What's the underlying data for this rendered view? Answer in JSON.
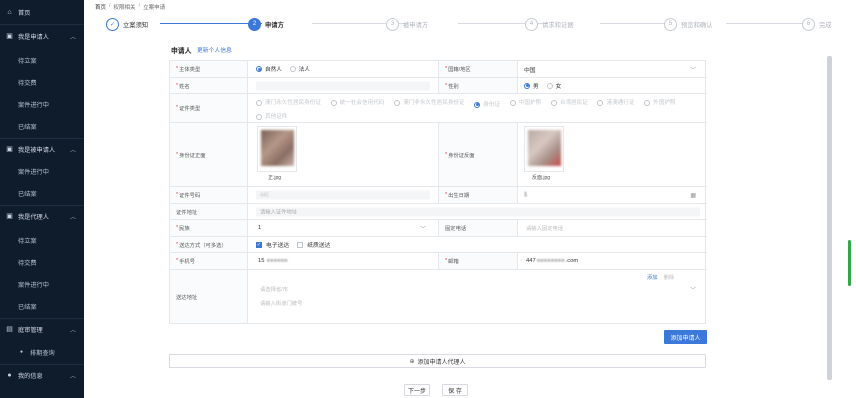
{
  "sidebar": {
    "home": "首页",
    "groups": [
      {
        "label": "我是申请人",
        "items": [
          "待立案",
          "待交费",
          "案件进行中",
          "已结案"
        ]
      },
      {
        "label": "我是被申请人",
        "items": [
          "案件进行中",
          "已结案"
        ]
      },
      {
        "label": "我是代理人",
        "items": [
          "待立案",
          "待交费",
          "案件进行中",
          "已结案"
        ]
      },
      {
        "label": "庭审管理",
        "items": [
          "排期查询"
        ]
      },
      {
        "label": "我的信息",
        "items": []
      }
    ]
  },
  "breadcrumb": [
    "首页",
    "权限相关",
    "立案申请"
  ],
  "steps": [
    {
      "num": "✓",
      "label": "立案须知",
      "state": "done"
    },
    {
      "num": "2",
      "label": "申请方",
      "state": "active"
    },
    {
      "num": "3",
      "label": "被申请方",
      "state": "todo"
    },
    {
      "num": "4",
      "label": "请求和证据",
      "state": "todo"
    },
    {
      "num": "5",
      "label": "预览和确认",
      "state": "todo"
    },
    {
      "num": "6",
      "label": "完成",
      "state": "todo"
    }
  ],
  "section": {
    "title": "申请人",
    "update_link": "更新个人信息"
  },
  "form": {
    "subject_type": {
      "label": "主体类型",
      "options": [
        "自然人",
        "法人"
      ],
      "selected": "自然人"
    },
    "nationality": {
      "label": "国籍/地区",
      "value": "中国"
    },
    "name": {
      "label": "姓名",
      "value": ""
    },
    "gender": {
      "label": "性别",
      "options": [
        "男",
        "女"
      ],
      "selected": "男"
    },
    "id_type": {
      "label": "证件类型",
      "options": [
        "澳门永久性居民身份证",
        "统一社会信用代码",
        "澳门非永久性居民身份证",
        "身份证",
        "中国护照",
        "台湾居民证",
        "港澳通行证",
        "外国护照",
        "其他证件"
      ],
      "selected": "身份证"
    },
    "id_front": {
      "label": "身份证正面",
      "caption": "正.jpg"
    },
    "id_back": {
      "label": "身份证反面",
      "caption": "反面.jpg"
    },
    "id_number": {
      "label": "证件号码",
      "value": "441"
    },
    "birth_date": {
      "label": "出生日期",
      "value": "1"
    },
    "id_address": {
      "label": "证件地址",
      "placeholder": "请输入证件地址"
    },
    "ethnicity": {
      "label": "民族",
      "value": "1"
    },
    "landline": {
      "label": "固定电话",
      "placeholder": "请输入固定电话"
    },
    "delivery": {
      "label": "送达方式（可多选）",
      "options": [
        "电子送达",
        "纸质送达"
      ],
      "checked": [
        "电子送达"
      ]
    },
    "phone": {
      "label": "手机号",
      "value": "15"
    },
    "email": {
      "label": "邮箱",
      "value": "447",
      "suffix": ".com"
    },
    "delivery_address": {
      "label": "送达地址",
      "region_placeholder": "请选择省/市",
      "detail_placeholder": "请输入街道门牌号",
      "add_link": "添加",
      "delete_link": "删除"
    }
  },
  "buttons": {
    "add_applicant": "添加申请人",
    "add_agent": "添加申请人代理人",
    "prev": "下一步",
    "save": "保 存"
  }
}
